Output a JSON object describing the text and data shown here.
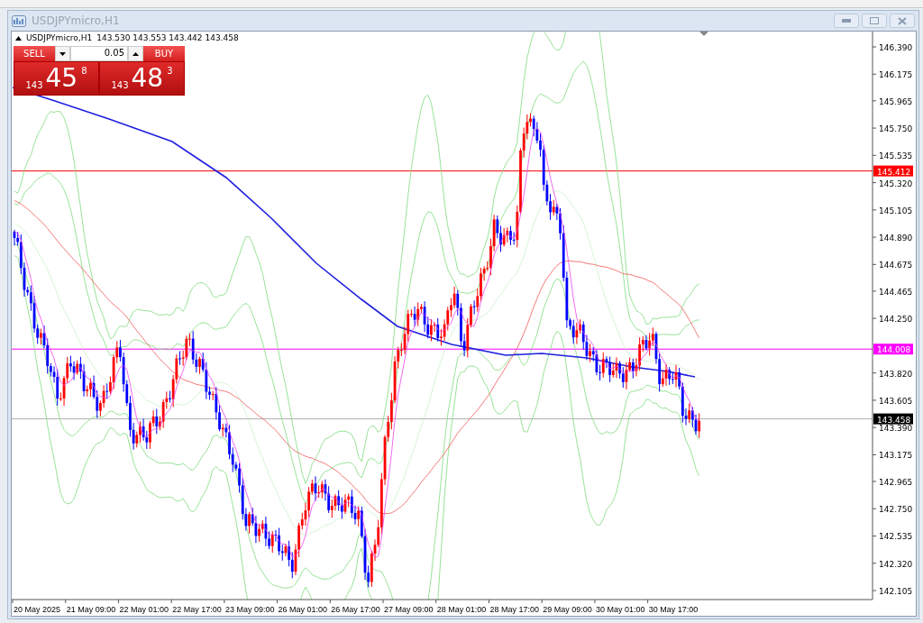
{
  "window": {
    "title": "USDJPYmicro,H1"
  },
  "chart": {
    "header": {
      "symbol": "USDJPYmicro,H1",
      "ohlc": "143.530 143.553 143.442 143.458"
    },
    "trade_panel": {
      "sell_label": "SELL",
      "buy_label": "BUY",
      "lot": "0.05",
      "sell_price": {
        "prefix": "143",
        "main": "45",
        "sup": "8"
      },
      "buy_price": {
        "prefix": "143",
        "main": "48",
        "sup": "3"
      }
    },
    "price_axis": [
      "146.390",
      "146.175",
      "145.965",
      "145.750",
      "145.535",
      "145.320",
      "145.105",
      "144.890",
      "144.675",
      "144.465",
      "144.250",
      "143.820",
      "143.605",
      "143.390",
      "143.175",
      "142.965",
      "142.750",
      "142.535",
      "142.320",
      "142.105"
    ],
    "price_lines": [
      {
        "label": "145.412",
        "color": "#ff0000"
      },
      {
        "label": "144.008",
        "color": "#ff00ff"
      },
      {
        "label": "143.458",
        "color": "#000000"
      }
    ],
    "time_axis": [
      "20 May 2025",
      "21 May 09:00",
      "22 May 01:00",
      "22 May 17:00",
      "23 May 09:00",
      "26 May 01:00",
      "26 May 17:00",
      "27 May 09:00",
      "28 May 01:00",
      "28 May 17:00",
      "29 May 09:00",
      "30 May 01:00",
      "30 May 17:00"
    ]
  }
}
